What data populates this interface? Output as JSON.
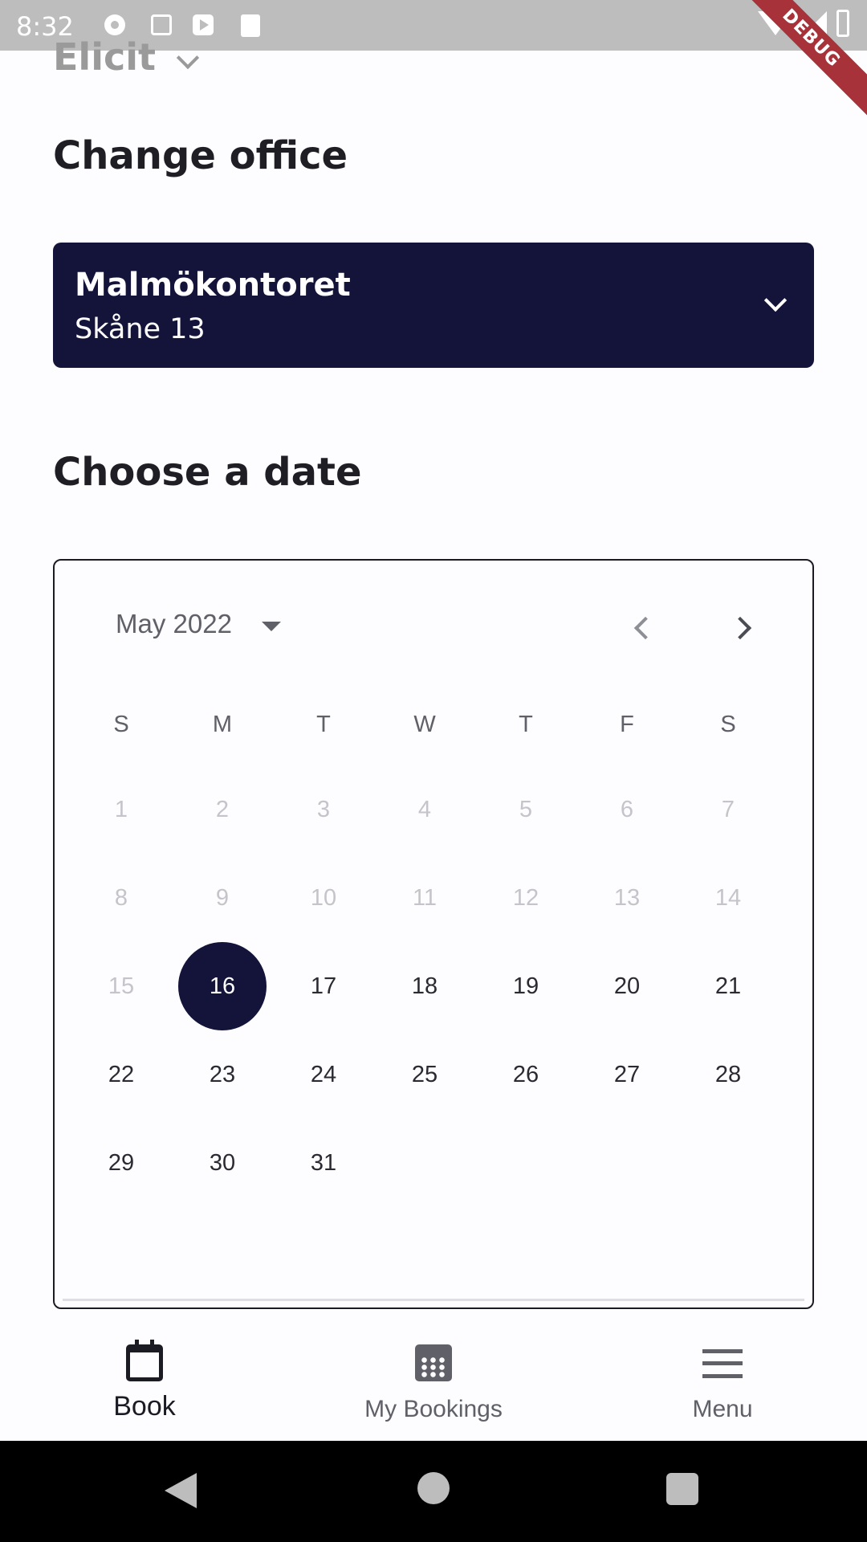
{
  "status_bar": {
    "time": "8:32"
  },
  "debug_banner": "DEBUG",
  "header": {
    "brand": "Elicit"
  },
  "change_office": {
    "title": "Change office",
    "office_name": "Malmökontoret",
    "office_address": "Skåne 13"
  },
  "choose_date": {
    "title": "Choose a date",
    "month_label": "May 2022",
    "weekdays": [
      "S",
      "M",
      "T",
      "W",
      "T",
      "F",
      "S"
    ],
    "weeks": [
      [
        "1",
        "2",
        "3",
        "4",
        "5",
        "6",
        "7"
      ],
      [
        "8",
        "9",
        "10",
        "11",
        "12",
        "13",
        "14"
      ],
      [
        "15",
        "16",
        "17",
        "18",
        "19",
        "20",
        "21"
      ],
      [
        "22",
        "23",
        "24",
        "25",
        "26",
        "27",
        "28"
      ],
      [
        "29",
        "30",
        "31",
        "",
        "",
        "",
        ""
      ]
    ],
    "selected_day": "16",
    "first_enabled_day": 16
  },
  "bottom_nav": {
    "items": [
      {
        "label": "Book",
        "icon": "calendar-icon",
        "active": true
      },
      {
        "label": "My Bookings",
        "icon": "calendar-grid-icon",
        "active": false
      },
      {
        "label": "Menu",
        "icon": "menu-icon",
        "active": false
      }
    ]
  },
  "colors": {
    "primary": "#14133a",
    "text": "#1e1e24",
    "muted": "#5f6068",
    "disabled": "#c4c4ca"
  }
}
